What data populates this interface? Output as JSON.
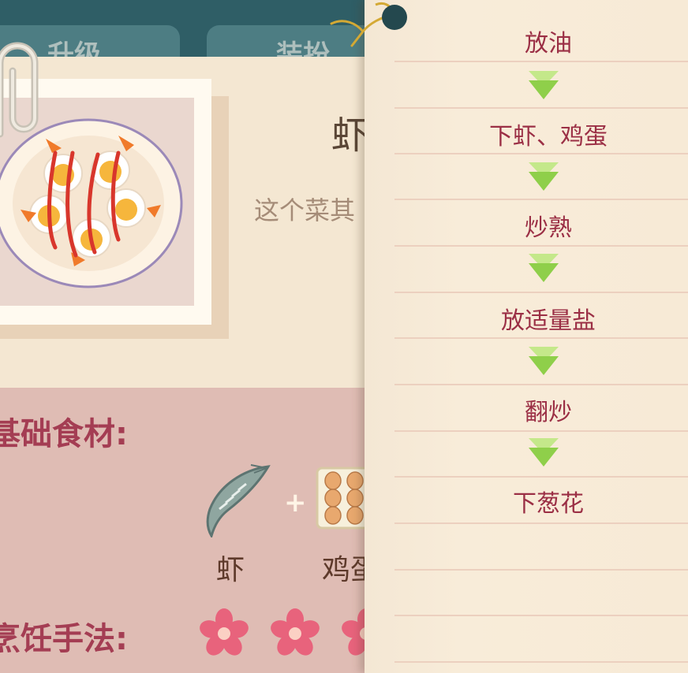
{
  "tabs": [
    {
      "label": "升级"
    },
    {
      "label": "装扮"
    }
  ],
  "dish": {
    "title": "虾",
    "description": "这个菜其"
  },
  "sections": {
    "ingredients_label": "基础食材:",
    "method_label": "烹饪手法:"
  },
  "ingredients": [
    {
      "name": "虾",
      "icon": "shrimp-icon"
    },
    {
      "name": "鸡蛋",
      "icon": "egg-crate-icon"
    }
  ],
  "plus_symbol": "+",
  "method_rating_icons": [
    "flower-icon",
    "flower-icon",
    "flower-icon"
  ],
  "steps": [
    {
      "text": "放油"
    },
    {
      "text": "下虾、鸡蛋"
    },
    {
      "text": "炒熟"
    },
    {
      "text": "放适量盐"
    },
    {
      "text": "翻炒"
    },
    {
      "text": "下葱花"
    }
  ],
  "colors": {
    "header": "#2f5e66",
    "card": "#f4e7d2",
    "pink_area": "#dfbcb4",
    "section_label": "#a43d53",
    "step_text": "#9b2f45",
    "arrow": "#9fd65a",
    "flower": "#e8637c"
  }
}
